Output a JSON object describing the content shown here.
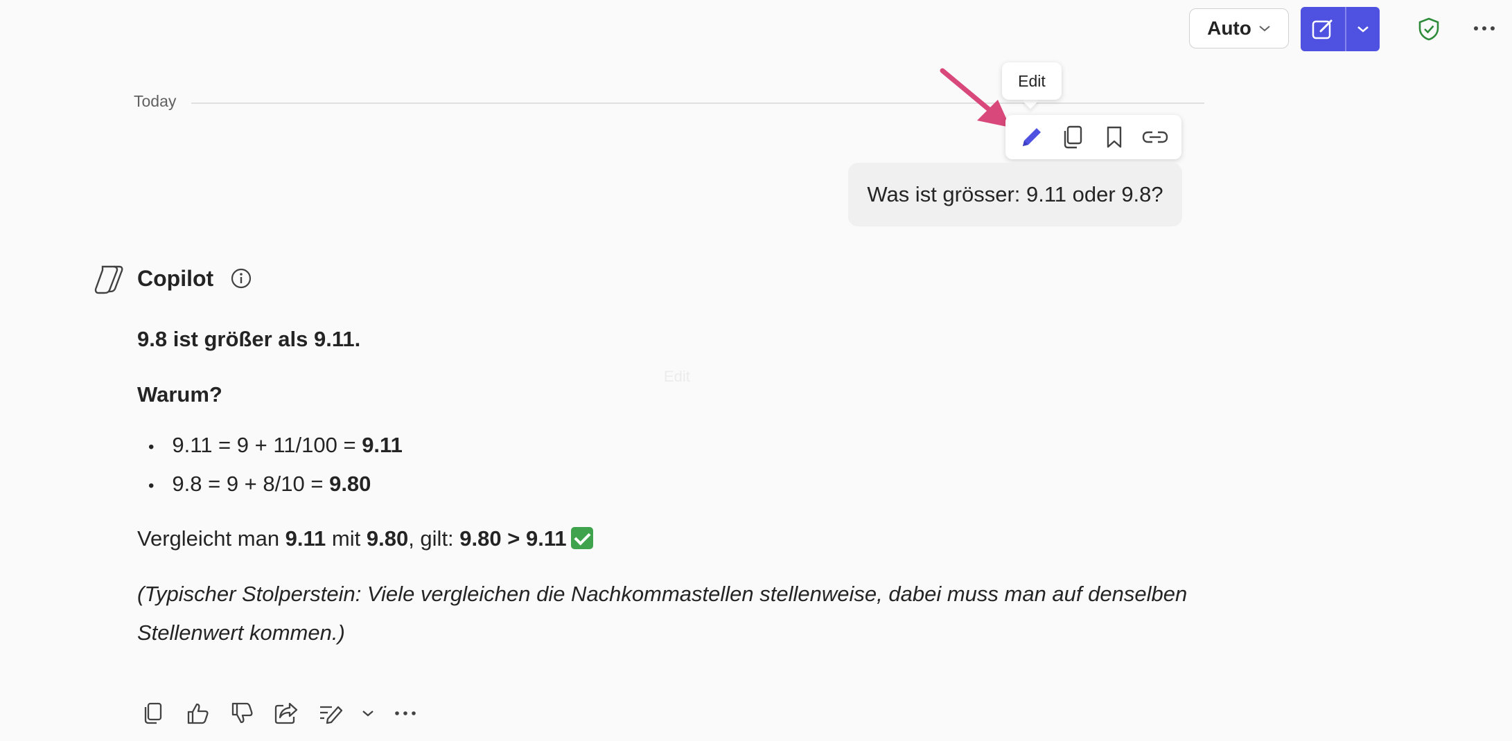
{
  "header": {
    "mode_label": "Auto",
    "icons": [
      "chevron-down-icon",
      "compose-icon",
      "shield-check-icon",
      "more-icon"
    ],
    "accent_color": "#4f52e0"
  },
  "conversation": {
    "date_label": "Today",
    "tooltip": "Edit",
    "message_toolbar": [
      "edit-icon",
      "copy-icon",
      "bookmark-icon",
      "link-icon"
    ],
    "user_message": "Was ist grösser: 9.11 oder 9.8?"
  },
  "copilot": {
    "name": "Copilot",
    "answer": "9.8 ist größer als 9.11.",
    "why_heading": "Warum?",
    "bullets": [
      {
        "expr": "9.11 = 9 + 11/100 = ",
        "result": "9.11"
      },
      {
        "expr": "9.8 = 9 + 8/10 = ",
        "result": "9.80"
      }
    ],
    "compare": {
      "t1": "Vergleicht man ",
      "v1": "9.11",
      "t2": " mit ",
      "v2": "9.80",
      "t3": ", gilt: ",
      "v3": "9.80 > 9.11"
    },
    "note_line1": "(Typischer Stolperstein: Viele vergleichen die Nachkommastellen stellenweise, dabei muss man auf denselben",
    "note_line2": "Stellenwert kommen.)",
    "faint_text": "Edit"
  },
  "actions": [
    "copy-icon",
    "thumbs-up-icon",
    "thumbs-down-icon",
    "share-icon",
    "rewrite-icon",
    "chevron-down-icon",
    "more-icon"
  ]
}
